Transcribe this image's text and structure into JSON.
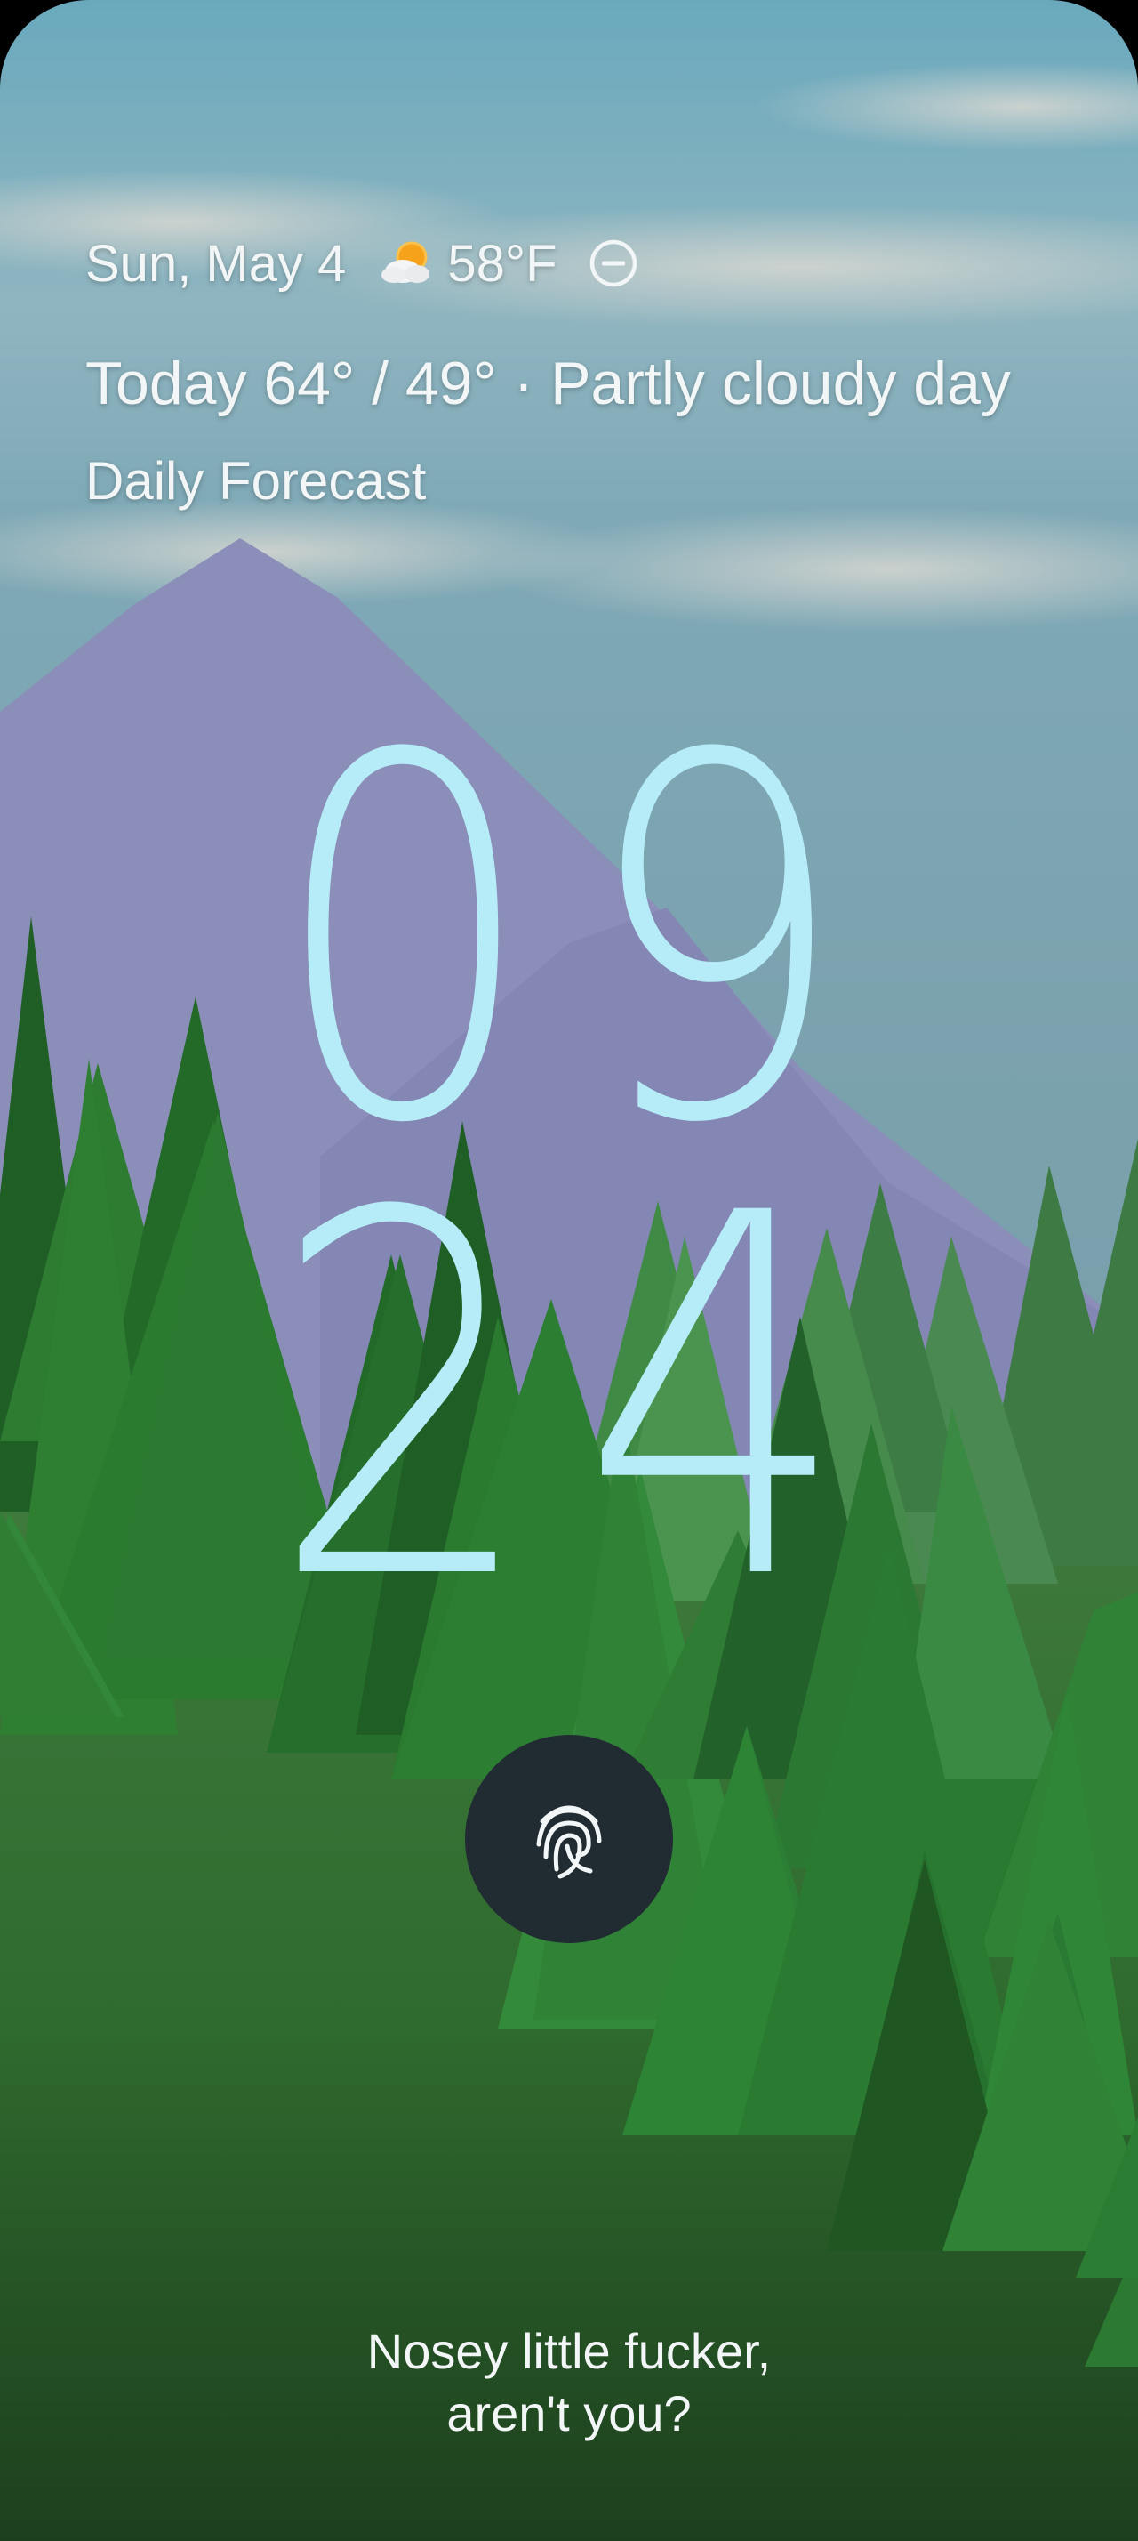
{
  "lockscreen": {
    "date": "Sun, May 4",
    "weather_icon": "partly-cloudy-icon",
    "temperature": "58°F",
    "dnd_icon": "do-not-disturb-icon",
    "forecast_summary": "Today 64° / 49° · Partly cloudy day",
    "forecast_link": "Daily Forecast"
  },
  "clock": {
    "hour_1": "0",
    "hour_2": "9",
    "minute_1": "2",
    "minute_2": "4",
    "color": "#b6ecf8"
  },
  "unlock": {
    "icon": "fingerprint-icon"
  },
  "owner_message": {
    "line_1": "Nosey little fucker,",
    "line_2": "aren't you?"
  }
}
